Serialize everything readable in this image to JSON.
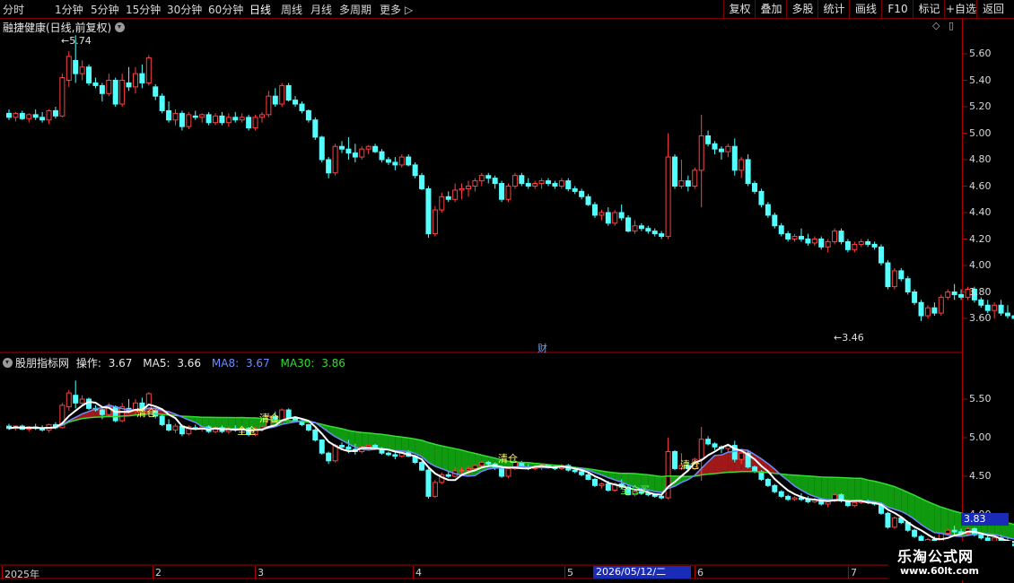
{
  "toolbar": {
    "periods": [
      "分时",
      "1分钟",
      "5分钟",
      "15分钟",
      "30分钟",
      "60分钟",
      "日线",
      "周线",
      "月线",
      "多周期",
      "更多"
    ],
    "active": "日线",
    "right_buttons": [
      "复权",
      "叠加",
      "多股",
      "统计",
      "画线",
      "F10",
      "标记",
      "+自选",
      "返回"
    ]
  },
  "title": "融捷健康(日线,前复权)",
  "upper_axis": {
    "ticks": [
      "5.60",
      "5.40",
      "5.20",
      "5.00",
      "4.80",
      "4.60",
      "4.40",
      "4.20",
      "4.00",
      "3.80",
      "3.60"
    ]
  },
  "upper_labels": {
    "high": "5.74",
    "low": "3.46",
    "cai": "财"
  },
  "indicator": {
    "name": "股朋指标网",
    "op_label": "操作:",
    "op_value": "3.67",
    "ma5_label": "MA5:",
    "ma5_value": "3.66",
    "ma8_label": "MA8:",
    "ma8_value": "3.67",
    "ma30_label": "MA30:",
    "ma30_value": "3.86",
    "colors": {
      "ma5": "#ffffff",
      "ma8": "#6f8cff",
      "ma30": "#33dd33"
    }
  },
  "lower_axis": {
    "ticks": [
      "5.50",
      "5.00",
      "4.50",
      "4.00"
    ]
  },
  "lower_labels": [
    "清仓",
    "全仓",
    "清仓",
    "清仓",
    "全仓买",
    "清仓"
  ],
  "price_badge": "3.83",
  "date_axis": {
    "labels": [
      "2025年",
      "2",
      "3",
      "4",
      "5",
      "6",
      "7"
    ],
    "cursor": "2026/05/12/二"
  },
  "watermark": {
    "line1": "乐淘公式网",
    "line2": "www.60lt.com"
  },
  "chart_data": {
    "type": "candlestick",
    "colors": {
      "up": "#ff4040",
      "down": "#54ffff"
    },
    "ohlc": [
      [
        5.15,
        5.18,
        5.1,
        5.12
      ],
      [
        5.12,
        5.16,
        5.09,
        5.15
      ],
      [
        5.15,
        5.17,
        5.1,
        5.11
      ],
      [
        5.11,
        5.15,
        5.08,
        5.14
      ],
      [
        5.14,
        5.18,
        5.1,
        5.12
      ],
      [
        5.12,
        5.16,
        5.08,
        5.1
      ],
      [
        5.1,
        5.18,
        5.07,
        5.17
      ],
      [
        5.17,
        5.2,
        5.11,
        5.13
      ],
      [
        5.13,
        5.45,
        5.12,
        5.42
      ],
      [
        5.4,
        5.62,
        5.35,
        5.58
      ],
      [
        5.55,
        5.74,
        5.38,
        5.45
      ],
      [
        5.45,
        5.55,
        5.4,
        5.5
      ],
      [
        5.5,
        5.52,
        5.36,
        5.38
      ],
      [
        5.38,
        5.42,
        5.34,
        5.36
      ],
      [
        5.36,
        5.38,
        5.24,
        5.3
      ],
      [
        5.3,
        5.45,
        5.28,
        5.4
      ],
      [
        5.4,
        5.42,
        5.2,
        5.22
      ],
      [
        5.22,
        5.45,
        5.2,
        5.4
      ],
      [
        5.38,
        5.5,
        5.32,
        5.35
      ],
      [
        5.35,
        5.5,
        5.3,
        5.45
      ],
      [
        5.45,
        5.52,
        5.34,
        5.38
      ],
      [
        5.38,
        5.59,
        5.36,
        5.57
      ],
      [
        5.35,
        5.37,
        5.25,
        5.28
      ],
      [
        5.28,
        5.3,
        5.15,
        5.17
      ],
      [
        5.17,
        5.24,
        5.08,
        5.1
      ],
      [
        5.1,
        5.18,
        5.06,
        5.15
      ],
      [
        5.15,
        5.17,
        5.02,
        5.05
      ],
      [
        5.05,
        5.16,
        5.03,
        5.14
      ],
      [
        5.13,
        5.17,
        5.1,
        5.12
      ],
      [
        5.12,
        5.15,
        5.08,
        5.14
      ],
      [
        5.14,
        5.16,
        5.06,
        5.08
      ],
      [
        5.08,
        5.15,
        5.06,
        5.13
      ],
      [
        5.13,
        5.16,
        5.06,
        5.08
      ],
      [
        5.08,
        5.15,
        5.05,
        5.12
      ],
      [
        5.12,
        5.16,
        5.08,
        5.1
      ],
      [
        5.1,
        5.15,
        5.08,
        5.12
      ],
      [
        5.12,
        5.14,
        5.02,
        5.04
      ],
      [
        5.04,
        5.14,
        5.02,
        5.12
      ],
      [
        5.12,
        5.16,
        5.08,
        5.14
      ],
      [
        5.14,
        5.32,
        5.12,
        5.28
      ],
      [
        5.28,
        5.34,
        5.2,
        5.22
      ],
      [
        5.22,
        5.38,
        5.2,
        5.36
      ],
      [
        5.36,
        5.38,
        5.24,
        5.25
      ],
      [
        5.25,
        5.28,
        5.2,
        5.22
      ],
      [
        5.22,
        5.24,
        5.15,
        5.17
      ],
      [
        5.17,
        5.18,
        5.08,
        5.1
      ],
      [
        5.1,
        5.12,
        4.95,
        4.97
      ],
      [
        4.97,
        4.98,
        4.78,
        4.8
      ],
      [
        4.8,
        4.82,
        4.66,
        4.7
      ],
      [
        4.7,
        4.92,
        4.68,
        4.9
      ],
      [
        4.9,
        4.94,
        4.85,
        4.88
      ],
      [
        4.88,
        4.97,
        4.8,
        4.85
      ],
      [
        4.85,
        4.92,
        4.78,
        4.82
      ],
      [
        4.82,
        4.9,
        4.8,
        4.88
      ],
      [
        4.88,
        4.91,
        4.84,
        4.9
      ],
      [
        4.9,
        4.92,
        4.85,
        4.86
      ],
      [
        4.86,
        4.88,
        4.78,
        4.8
      ],
      [
        4.8,
        4.82,
        4.76,
        4.78
      ],
      [
        4.78,
        4.82,
        4.72,
        4.76
      ],
      [
        4.76,
        4.84,
        4.74,
        4.82
      ],
      [
        4.82,
        4.84,
        4.75,
        4.76
      ],
      [
        4.76,
        4.78,
        4.66,
        4.68
      ],
      [
        4.68,
        4.7,
        4.57,
        4.58
      ],
      [
        4.58,
        4.6,
        4.21,
        4.24
      ],
      [
        4.24,
        4.45,
        4.22,
        4.42
      ],
      [
        4.42,
        4.55,
        4.4,
        4.52
      ],
      [
        4.52,
        4.56,
        4.48,
        4.5
      ],
      [
        4.5,
        4.62,
        4.48,
        4.57
      ],
      [
        4.57,
        4.62,
        4.5,
        4.58
      ],
      [
        4.58,
        4.64,
        4.52,
        4.6
      ],
      [
        4.6,
        4.66,
        4.56,
        4.64
      ],
      [
        4.64,
        4.7,
        4.6,
        4.68
      ],
      [
        4.68,
        4.7,
        4.62,
        4.66
      ],
      [
        4.66,
        4.68,
        4.58,
        4.62
      ],
      [
        4.62,
        4.64,
        4.48,
        4.5
      ],
      [
        4.5,
        4.62,
        4.48,
        4.6
      ],
      [
        4.6,
        4.7,
        4.58,
        4.68
      ],
      [
        4.68,
        4.7,
        4.6,
        4.62
      ],
      [
        4.62,
        4.66,
        4.58,
        4.6
      ],
      [
        4.6,
        4.64,
        4.58,
        4.62
      ],
      [
        4.62,
        4.66,
        4.58,
        4.64
      ],
      [
        4.64,
        4.66,
        4.6,
        4.62
      ],
      [
        4.62,
        4.64,
        4.58,
        4.6
      ],
      [
        4.6,
        4.66,
        4.58,
        4.64
      ],
      [
        4.64,
        4.66,
        4.56,
        4.58
      ],
      [
        4.58,
        4.6,
        4.54,
        4.56
      ],
      [
        4.56,
        4.58,
        4.5,
        4.52
      ],
      [
        4.52,
        4.54,
        4.45,
        4.46
      ],
      [
        4.46,
        4.48,
        4.36,
        4.38
      ],
      [
        4.38,
        4.42,
        4.34,
        4.4
      ],
      [
        4.4,
        4.44,
        4.3,
        4.32
      ],
      [
        4.32,
        4.42,
        4.3,
        4.4
      ],
      [
        4.4,
        4.46,
        4.34,
        4.36
      ],
      [
        4.36,
        4.38,
        4.25,
        4.26
      ],
      [
        4.26,
        4.34,
        4.24,
        4.3
      ],
      [
        4.3,
        4.32,
        4.26,
        4.28
      ],
      [
        4.28,
        4.3,
        4.24,
        4.26
      ],
      [
        4.26,
        4.28,
        4.22,
        4.24
      ],
      [
        4.24,
        4.26,
        4.2,
        4.22
      ],
      [
        4.22,
        5.0,
        4.2,
        4.82
      ],
      [
        4.82,
        4.84,
        4.58,
        4.6
      ],
      [
        4.6,
        4.8,
        4.58,
        4.64
      ],
      [
        4.64,
        4.68,
        4.56,
        4.6
      ],
      [
        4.6,
        4.74,
        4.58,
        4.72
      ],
      [
        4.72,
        5.14,
        4.44,
        4.98
      ],
      [
        4.98,
        5.02,
        4.9,
        4.92
      ],
      [
        4.92,
        4.94,
        4.84,
        4.88
      ],
      [
        4.88,
        4.9,
        4.8,
        4.86
      ],
      [
        4.86,
        4.92,
        4.82,
        4.9
      ],
      [
        4.9,
        4.96,
        4.68,
        4.72
      ],
      [
        4.72,
        4.82,
        4.66,
        4.8
      ],
      [
        4.8,
        4.84,
        4.6,
        4.62
      ],
      [
        4.62,
        4.64,
        4.54,
        4.56
      ],
      [
        4.56,
        4.58,
        4.44,
        4.46
      ],
      [
        4.46,
        4.48,
        4.36,
        4.38
      ],
      [
        4.38,
        4.4,
        4.28,
        4.3
      ],
      [
        4.3,
        4.32,
        4.22,
        4.24
      ],
      [
        4.24,
        4.26,
        4.18,
        4.2
      ],
      [
        4.2,
        4.24,
        4.18,
        4.22
      ],
      [
        4.22,
        4.28,
        4.18,
        4.2
      ],
      [
        4.2,
        4.24,
        4.15,
        4.17
      ],
      [
        4.17,
        4.22,
        4.15,
        4.2
      ],
      [
        4.2,
        4.22,
        4.12,
        4.14
      ],
      [
        4.14,
        4.2,
        4.1,
        4.18
      ],
      [
        4.18,
        4.28,
        4.16,
        4.26
      ],
      [
        4.26,
        4.28,
        4.16,
        4.18
      ],
      [
        4.18,
        4.2,
        4.1,
        4.12
      ],
      [
        4.12,
        4.18,
        4.1,
        4.16
      ],
      [
        4.16,
        4.2,
        4.14,
        4.18
      ],
      [
        4.18,
        4.2,
        4.14,
        4.16
      ],
      [
        4.16,
        4.18,
        4.12,
        4.14
      ],
      [
        4.14,
        4.16,
        4.0,
        4.02
      ],
      [
        4.02,
        4.04,
        3.82,
        3.84
      ],
      [
        3.84,
        3.98,
        3.82,
        3.96
      ],
      [
        3.96,
        3.98,
        3.88,
        3.9
      ],
      [
        3.9,
        3.92,
        3.78,
        3.8
      ],
      [
        3.8,
        3.82,
        3.7,
        3.72
      ],
      [
        3.72,
        3.74,
        3.58,
        3.62
      ],
      [
        3.62,
        3.7,
        3.6,
        3.68
      ],
      [
        3.68,
        3.72,
        3.62,
        3.64
      ],
      [
        3.64,
        3.78,
        3.62,
        3.76
      ],
      [
        3.76,
        3.82,
        3.74,
        3.8
      ],
      [
        3.8,
        3.86,
        3.74,
        3.78
      ],
      [
        3.78,
        3.82,
        3.74,
        3.76
      ],
      [
        3.76,
        3.84,
        3.74,
        3.82
      ],
      [
        3.82,
        3.84,
        3.72,
        3.74
      ],
      [
        3.74,
        3.76,
        3.68,
        3.7
      ],
      [
        3.7,
        3.74,
        3.64,
        3.66
      ],
      [
        3.66,
        3.72,
        3.6,
        3.7
      ],
      [
        3.7,
        3.74,
        3.62,
        3.64
      ],
      [
        3.64,
        3.7,
        3.6,
        3.62
      ],
      [
        3.62,
        3.66,
        3.56,
        3.6
      ],
      [
        3.6,
        3.7,
        3.58,
        3.68
      ],
      [
        3.68,
        3.74,
        3.64,
        3.72
      ],
      [
        3.72,
        3.78,
        3.66,
        3.74
      ],
      [
        3.74,
        3.76,
        3.68,
        3.7
      ]
    ],
    "upper_ylim": [
      3.4,
      5.8
    ],
    "lower_ylim": [
      3.7,
      5.95
    ]
  }
}
